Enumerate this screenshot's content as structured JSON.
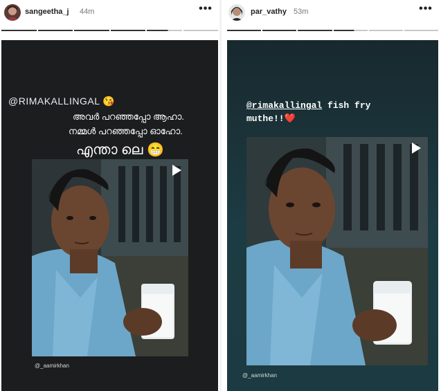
{
  "stories": [
    {
      "username": "sangeetha_j",
      "time": "44m",
      "more_label": "•••",
      "mention": "@RIMAKALLINGAL",
      "mention_emoji": "😘",
      "caption_line1": "അവർ പറഞ്ഞപ്പോ ആഹാ.",
      "caption_line2": "നമ്മൾ പറഞ്ഞപ്പോ ഓഹോ.",
      "caption_line3": "എന്താ ലെ",
      "caption_emoji": "😁",
      "credit": "@_aamirkhan"
    },
    {
      "username": "par_vathy",
      "time": "53m",
      "more_label": "•••",
      "mention": "@rimakallingal",
      "mention_rest": " fish fry",
      "caption_line2": "muthe!!",
      "heart": "❤️",
      "credit": "@_aamirkhan"
    }
  ],
  "colors": {
    "left_bg": "#1b1d1f",
    "right_bg": "#1c3c43",
    "progress_active": "#333333",
    "progress_inactive": "#c8c8c8"
  },
  "icons": [
    "more-options-icon",
    "play-icon",
    "avatar"
  ]
}
